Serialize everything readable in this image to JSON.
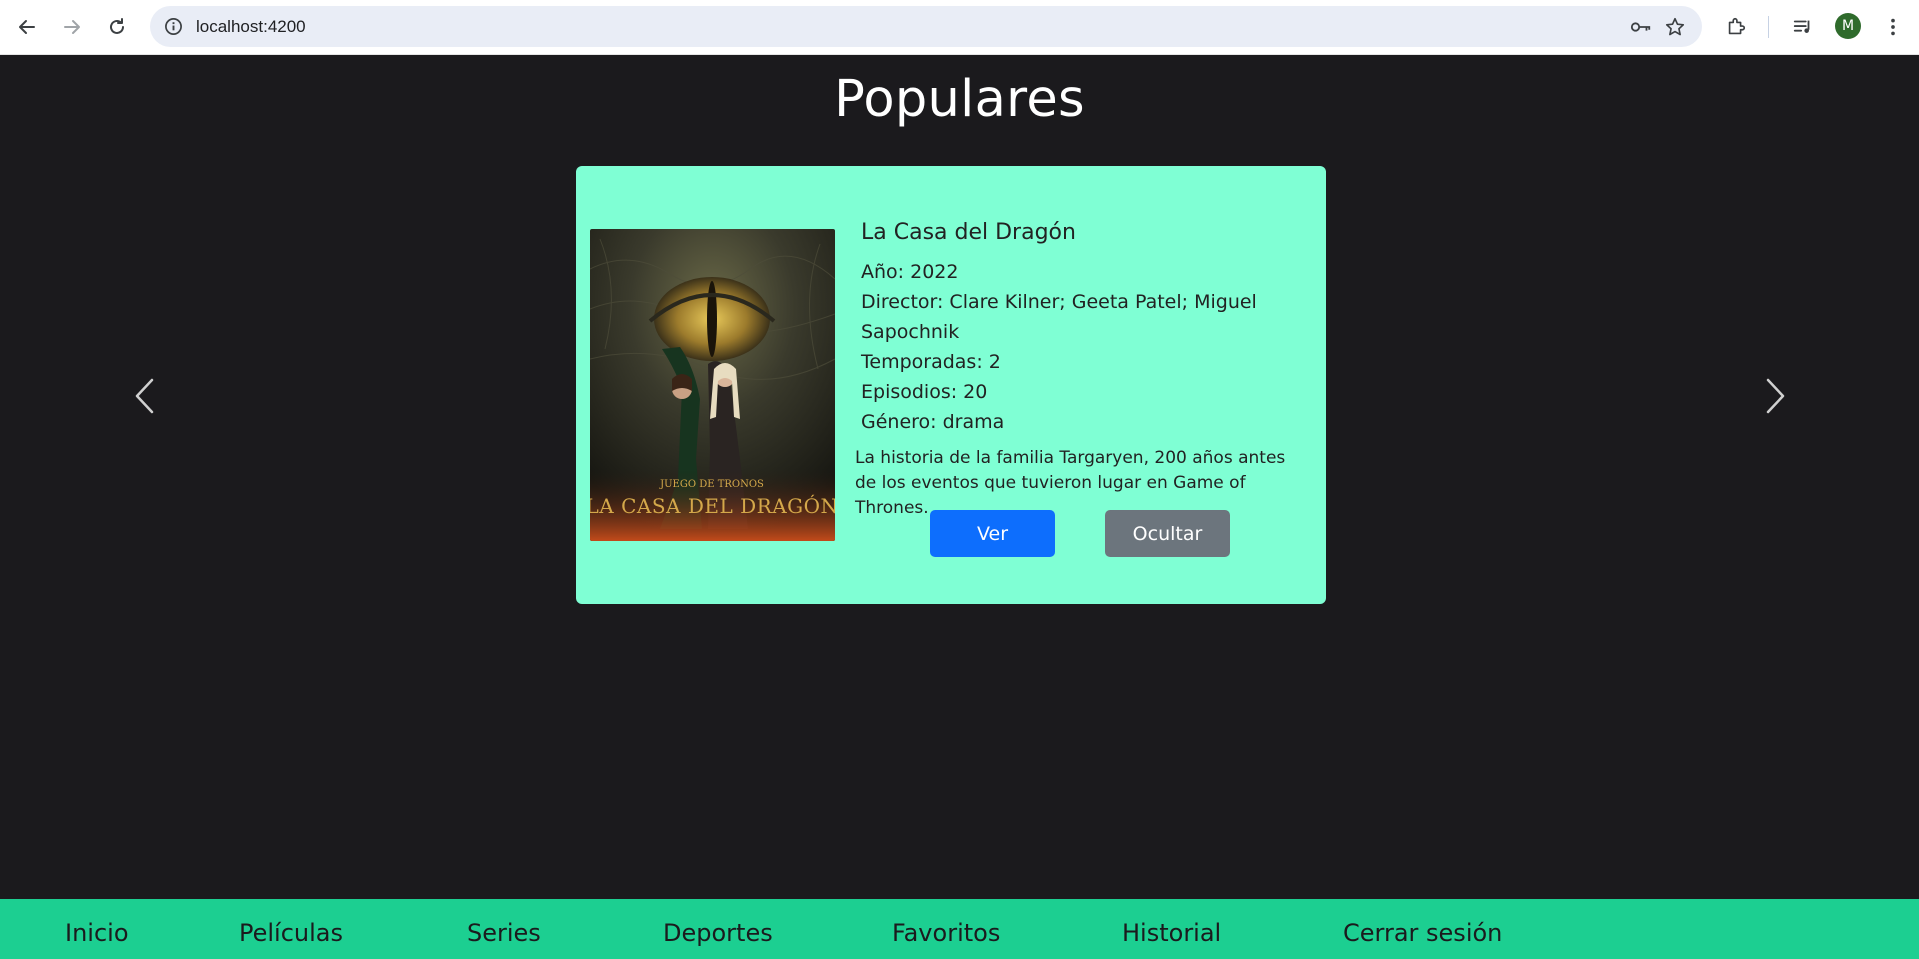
{
  "browser": {
    "url": "localhost:4200",
    "avatar_letter": "M"
  },
  "page": {
    "title": "Populares"
  },
  "card": {
    "title": "La Casa del Dragón",
    "year": "Año: 2022",
    "director_line1": "Director: Clare Kilner; Geeta Patel; Miguel",
    "director_line2": "Sapochnik",
    "seasons": "Temporadas: 2",
    "episodes": "Episodios: 20",
    "genre": "Género: drama",
    "description": "La historia de la familia Targaryen, 200 años antes de los eventos que tuvieron lugar en Game of Thrones.",
    "poster": {
      "top_text": "JUEGO DE TRONOS",
      "main_text": "LA CASA DEL DRAGÓN"
    },
    "buttons": {
      "ver": "Ver",
      "ocultar": "Ocultar"
    }
  },
  "bottom_nav": {
    "items": [
      "Inicio",
      "Películas",
      "Series",
      "Deportes",
      "Favoritos",
      "Historial",
      "Cerrar sesión"
    ]
  },
  "colors": {
    "background": "#1b1a1d",
    "card": "#7fffd4",
    "nav": "#1ccf91",
    "primary_button": "#0d6efd",
    "secondary_button": "#6c757d"
  }
}
